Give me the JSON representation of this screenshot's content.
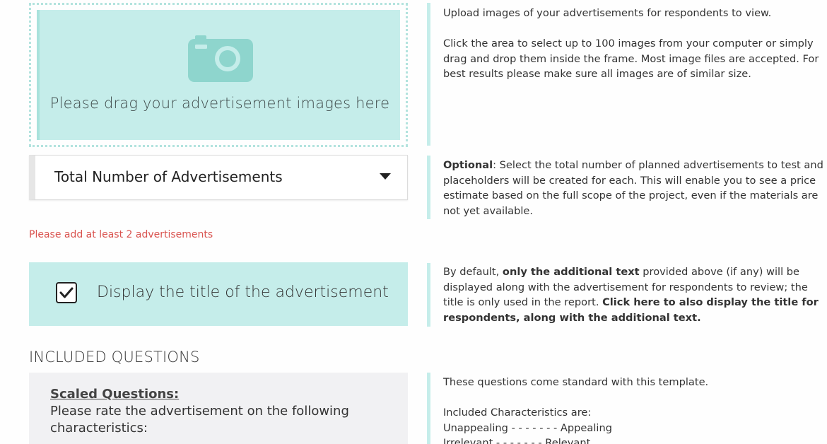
{
  "upload": {
    "dropzone_text": "Please drag your advertisement images here",
    "icon": "camera-icon",
    "help_line1": "Upload images of your advertisements for respondents to view.",
    "help_line2": "Click the area to select up to 100 images from your computer or simply drag and drop them inside the frame. Most image files are accepted. For best results please make sure all images are of similar size."
  },
  "total_ads": {
    "select_label": "Total Number of Advertisements",
    "help_bold": "Optional",
    "help_rest": ": Select the total number of planned advertisements to test and placeholders will be created for each. This will enable you to see a price estimate based on the full scope of the project, even if the materials are not yet available."
  },
  "validation": {
    "error": "Please add at least 2 advertisements"
  },
  "display_title": {
    "checked": true,
    "label": "Display the title of the advertisement",
    "help_part1": "By default, ",
    "help_bold1": "only the additional text",
    "help_part2": " provided above (if any) will be displayed along with the advertisement for respondents to review; the title is only used in the report. ",
    "help_bold2": "Click here to also display the title for respondents, along with the additional text."
  },
  "included": {
    "heading": "INCLUDED QUESTIONS",
    "question_title": "Scaled Questions:",
    "question_text": "Please rate the advertisement on the following characteristics:",
    "help_line1": "These questions come standard with this template.",
    "help_line2": "Included Characteristics are:",
    "characteristics": [
      "Unappealing - - - - - - - Appealing",
      "Irrelevant - - - - - - - Relevant"
    ]
  },
  "colors": {
    "accent": "#c5edea",
    "error": "#d9534f"
  }
}
